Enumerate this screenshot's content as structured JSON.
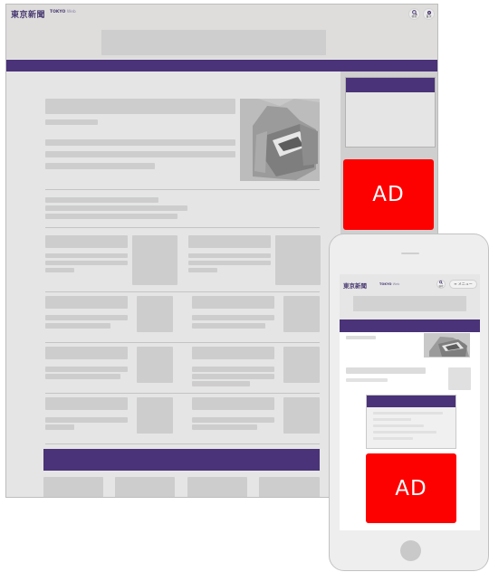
{
  "brand": {
    "logo_jp": "東京新聞",
    "logo_en": "TOKYO",
    "logo_en_suffix": "Web"
  },
  "desktop": {
    "search_label": "検索",
    "top_label": "首次",
    "ad_label": "AD"
  },
  "phone": {
    "search_label": "検索",
    "menu_label": "≡ メニュー",
    "ad_label": "AD"
  },
  "colors": {
    "brand_purple": "#4a3378",
    "ad_red": "#fd0000",
    "placeholder_gray": "#cecdcd",
    "page_gray": "#e5e5e5"
  },
  "icons": {
    "search": "magnifier-icon",
    "top": "gear-icon"
  }
}
